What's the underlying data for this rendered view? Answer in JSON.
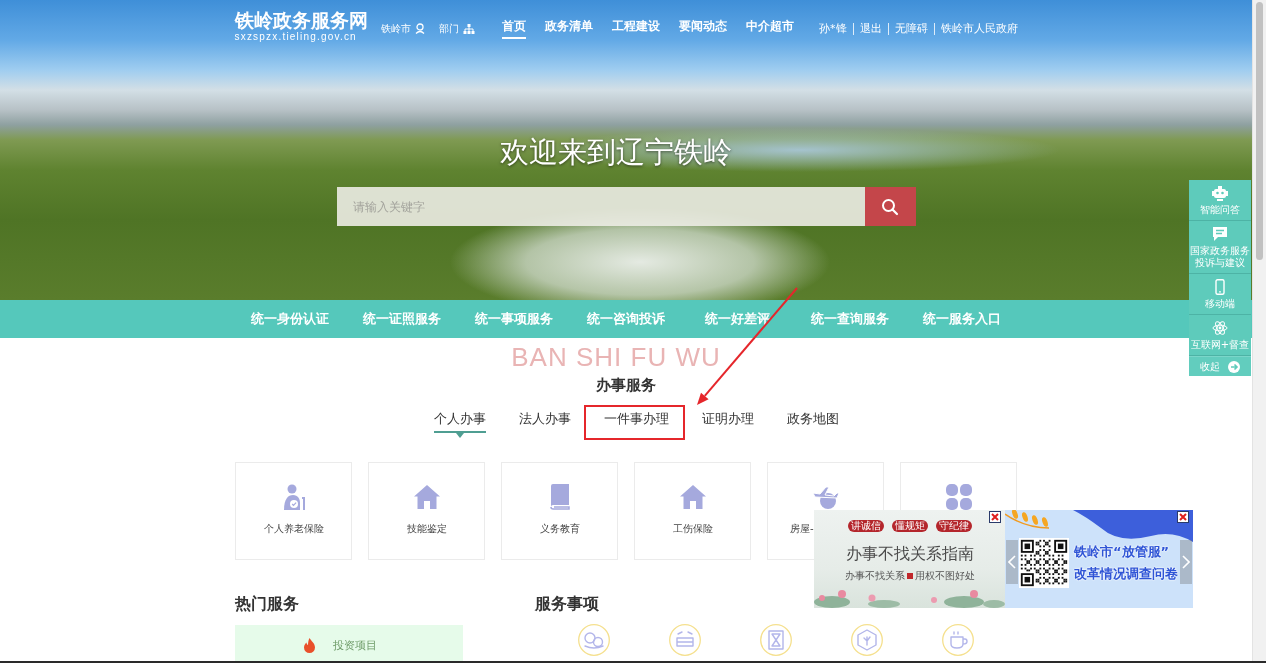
{
  "header": {
    "logo": "铁岭政务服务网",
    "domain": "sxzspzx.tieling.gov.cn",
    "region_links": [
      "铁岭市",
      "部门"
    ],
    "nav": [
      {
        "label": "首页",
        "selected": true
      },
      {
        "label": "政务清单",
        "selected": false
      },
      {
        "label": "工程建设",
        "selected": false
      },
      {
        "label": "要闻动态",
        "selected": false
      },
      {
        "label": "中介超市",
        "selected": false
      }
    ],
    "user_links": [
      "孙*锋",
      "退出",
      "无障碍",
      "铁岭市人民政府"
    ]
  },
  "hero": {
    "title": "欢迎来到辽宁铁岭",
    "search": {
      "placeholder": "请输入关键字"
    }
  },
  "service_bar": [
    "统一身份认证",
    "统一证照服务",
    "统一事项服务",
    "统一咨询投诉",
    "统一好差评",
    "统一查询服务",
    "统一服务入口"
  ],
  "affairs": {
    "background_text": "BAN SHI FU WU",
    "title": "办事服务",
    "tabs": [
      {
        "label": "个人办事",
        "selected": true,
        "highlighted": false
      },
      {
        "label": "法人办事",
        "selected": false,
        "highlighted": false
      },
      {
        "label": "一件事办理",
        "selected": false,
        "highlighted": true
      },
      {
        "label": "证明办理",
        "selected": false,
        "highlighted": false
      },
      {
        "label": "政务地图",
        "selected": false,
        "highlighted": false
      }
    ],
    "cards": [
      {
        "label": "个人养老保险"
      },
      {
        "label": "技能鉴定"
      },
      {
        "label": "义务教育"
      },
      {
        "label": "工伤保险"
      },
      {
        "label": "房屋-",
        "truncated": true
      }
    ]
  },
  "hot_services": {
    "title": "热门服务",
    "items": [
      "投资项目"
    ]
  },
  "service_items": {
    "title": "服务事项"
  },
  "float_ads": [
    {
      "kind": "poster",
      "seals": [
        "讲诚信",
        "懂规矩",
        "守纪律"
      ],
      "title": "办事不找关系指南",
      "subtitle": [
        "办事不找关系",
        "用权不图好处"
      ]
    },
    {
      "kind": "survey",
      "lines": [
        "铁岭市“放管服”",
        "改革情况调查问卷"
      ]
    }
  ],
  "side_dock": {
    "items": [
      "智能问答",
      "国家政务服务投诉与建议",
      "移动端",
      "互联网+督查"
    ],
    "collapse": "收起"
  }
}
